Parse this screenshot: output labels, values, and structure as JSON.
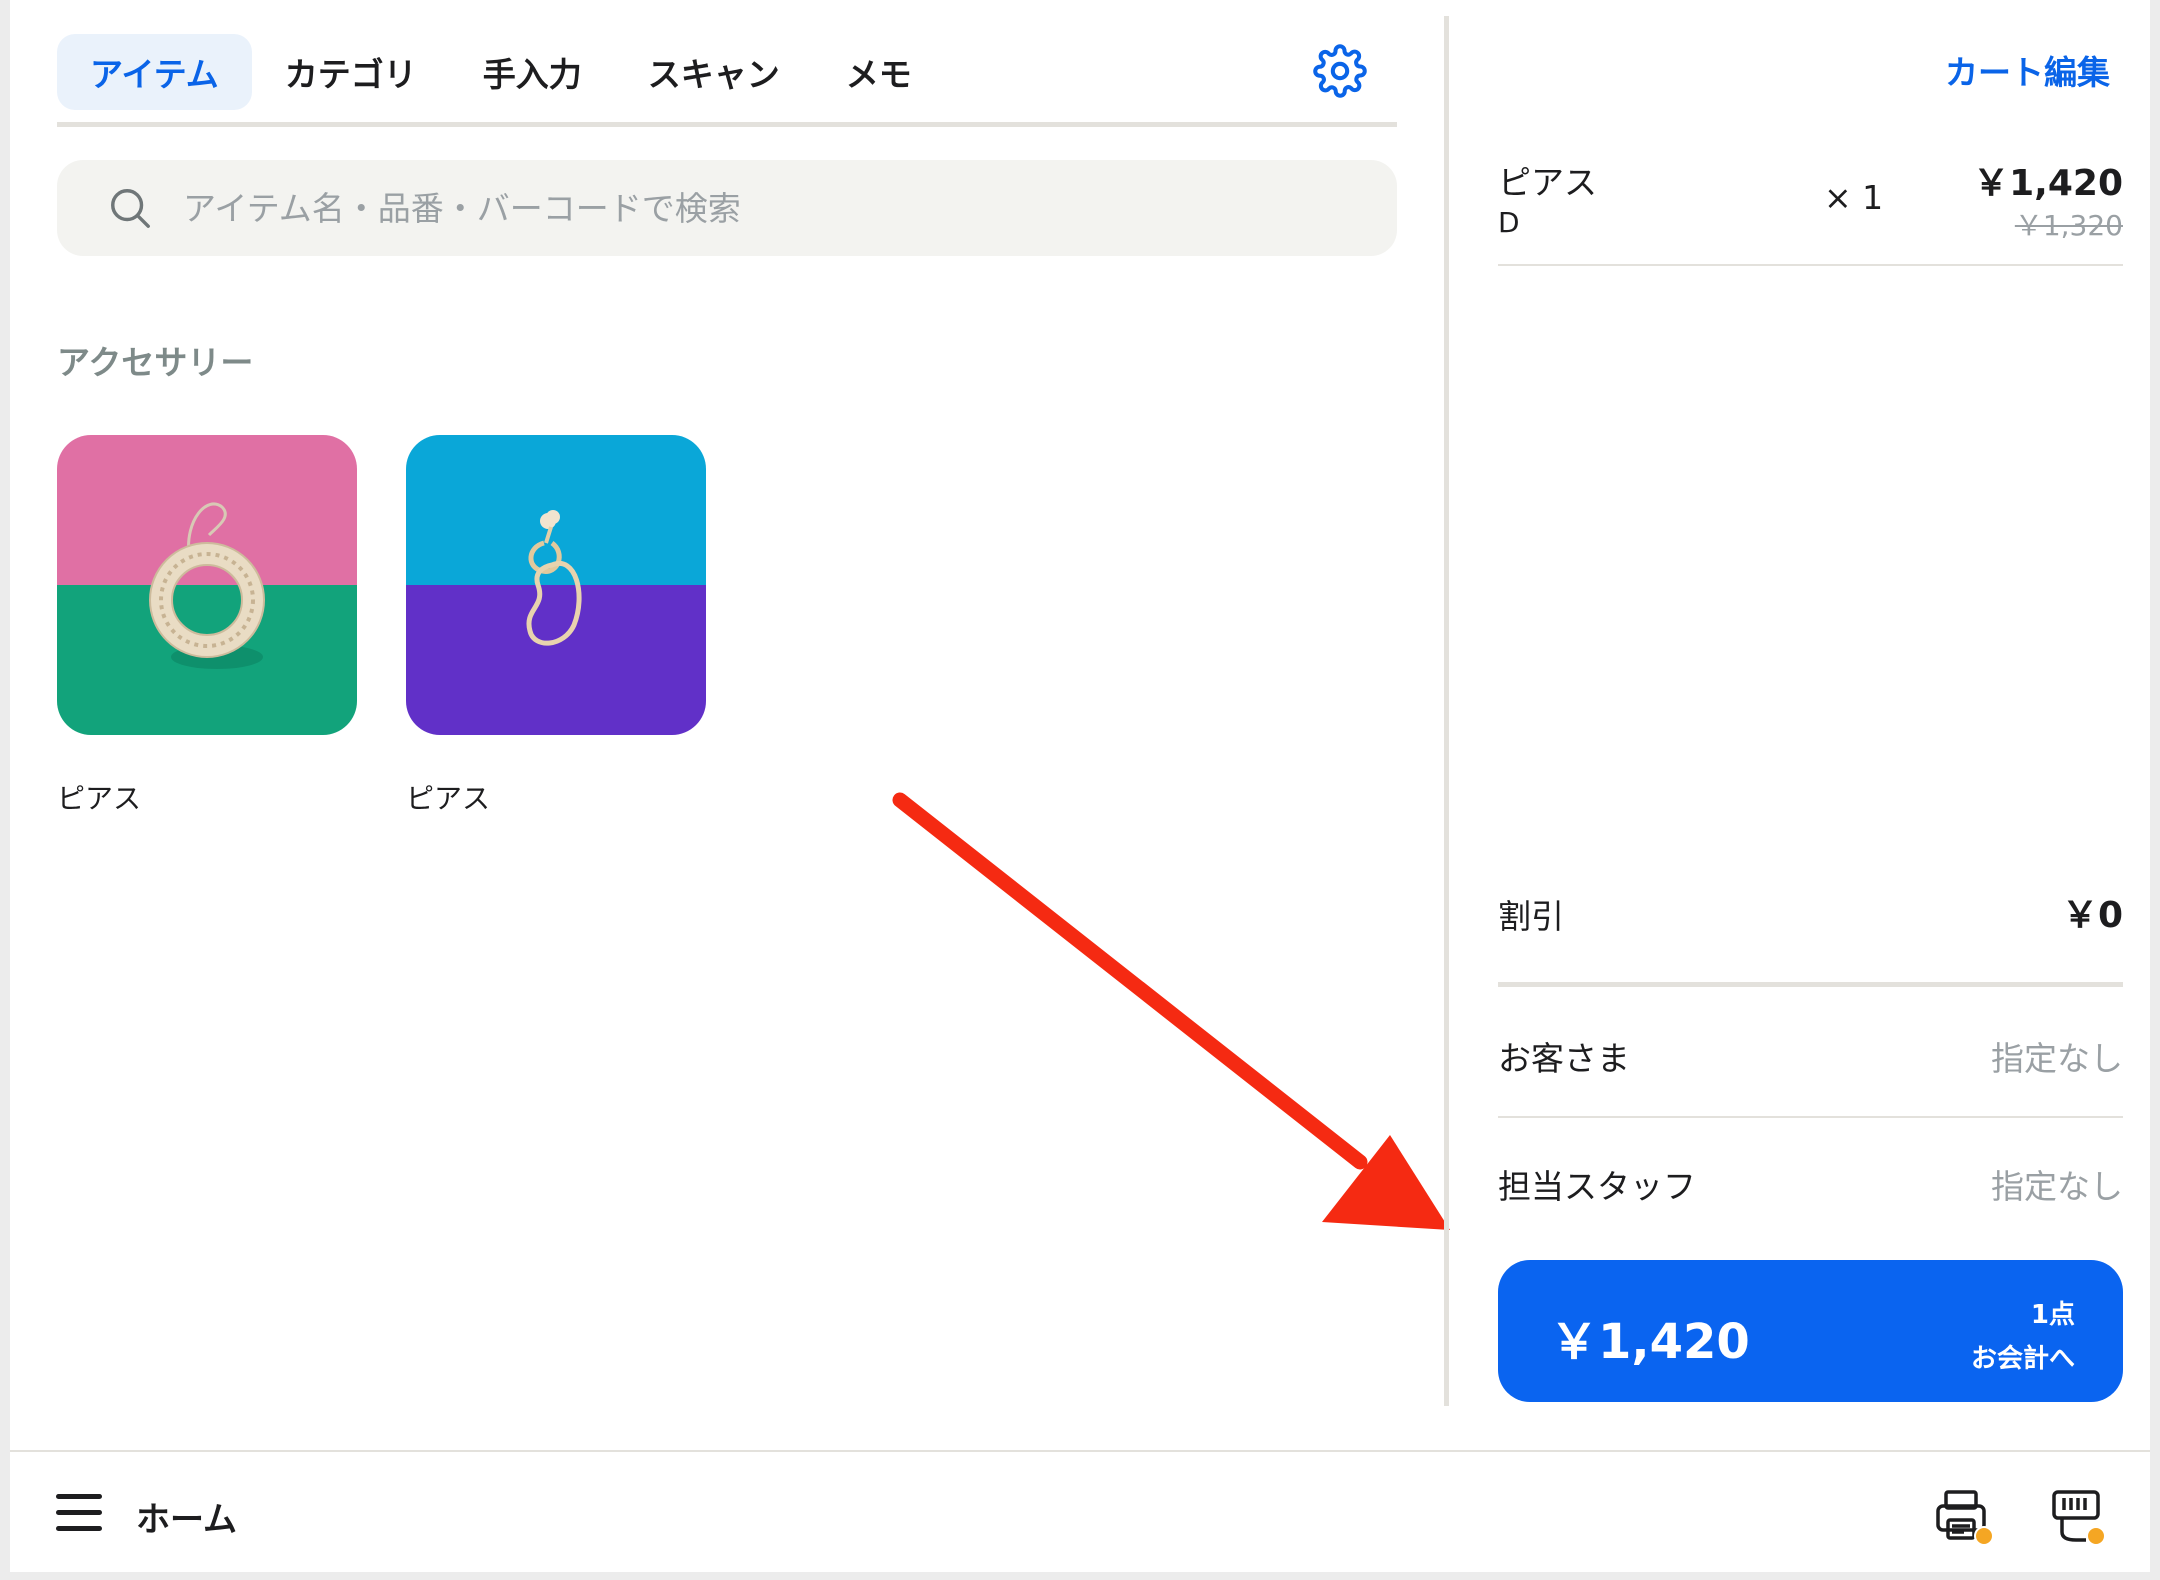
{
  "tabs": [
    {
      "label": "アイテム",
      "active": true
    },
    {
      "label": "カテゴリ",
      "active": false
    },
    {
      "label": "手入力",
      "active": false
    },
    {
      "label": "スキャン",
      "active": false
    },
    {
      "label": "メモ",
      "active": false
    }
  ],
  "search": {
    "placeholder": "アイテム名・品番・バーコードで検索"
  },
  "category": {
    "title": "アクセサリー",
    "items": [
      {
        "label": "ピアス",
        "colors": {
          "top": "#e070a4",
          "bottom": "#12a37b"
        }
      },
      {
        "label": "ピアス",
        "colors": {
          "top": "#0aa7d8",
          "bottom": "#6130c8"
        }
      }
    ]
  },
  "cart": {
    "edit_label": "カート編集",
    "lines": [
      {
        "name": "ピアス",
        "variant": "D",
        "qty": "× 1",
        "price": "￥1,420",
        "original_price": "￥1,320"
      }
    ],
    "discount": {
      "label": "割引",
      "value": "￥0"
    },
    "customer": {
      "label": "お客さま",
      "value": "指定なし"
    },
    "staff": {
      "label": "担当スタッフ",
      "value": "指定なし"
    },
    "checkout": {
      "total": "￥1,420",
      "count": "1点",
      "cta": "お会計へ"
    }
  },
  "bottom_bar": {
    "home_label": "ホーム"
  },
  "icons": {
    "gear": "gear-icon",
    "search": "search-icon",
    "menu": "hamburger-menu-icon",
    "printer": "printer-icon",
    "card_reader": "card-reader-icon"
  },
  "colors": {
    "accent": "#0a64e8",
    "checkout": "#0a64f0",
    "status_dot": "#f5a623",
    "arrow": "#f52a12"
  }
}
